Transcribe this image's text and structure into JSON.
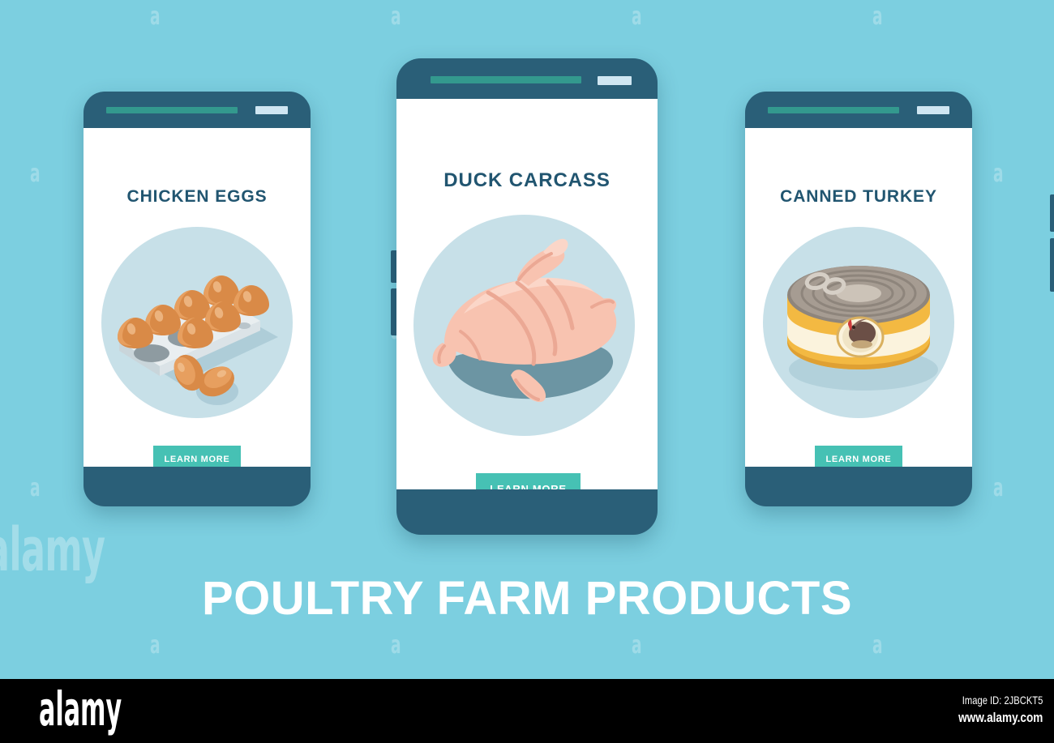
{
  "theme": {
    "background": "#7ccfe0",
    "phone_body": "#2a5f78",
    "screen": "#ffffff",
    "status_pill": "#33998e",
    "status_chip": "#cfe6f2",
    "title_color": "#215570",
    "art_circle": "#c7e0e8",
    "cta_color": "#46c1b4",
    "headline_color": "#ffffff",
    "footer_bg": "#000000"
  },
  "headline": "POULTRY FARM PRODUCTS",
  "cards": [
    {
      "id": "chicken-eggs",
      "title": "CHICKEN EGGS",
      "cta_label": "LEARN MORE",
      "illustration": "egg-carton-illustration"
    },
    {
      "id": "duck-carcass",
      "title": "DUCK CARCASS",
      "cta_label": "LEARN MORE",
      "illustration": "duck-carcass-illustration"
    },
    {
      "id": "canned-turkey",
      "title": "CANNED TURKEY",
      "cta_label": "LEARN MORE",
      "illustration": "canned-turkey-illustration"
    }
  ],
  "watermark": {
    "tile_glyph": "a",
    "large_glyph": "alamy"
  },
  "footer": {
    "logo": "alamy",
    "image_id": "Image ID: 2JBCKT5",
    "url": "www.alamy.com"
  }
}
